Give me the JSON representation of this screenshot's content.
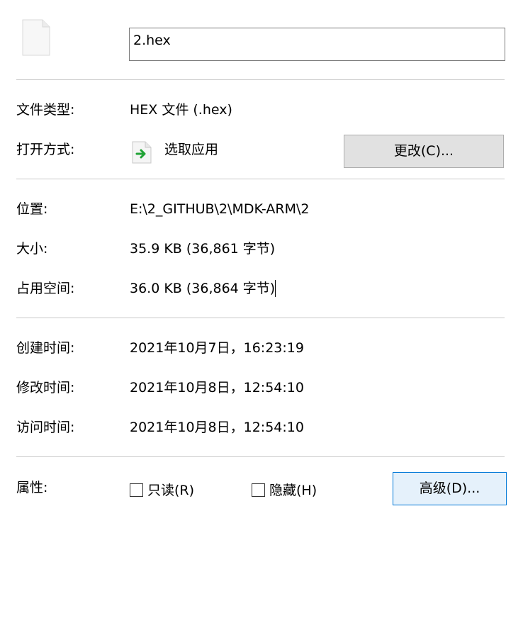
{
  "file": {
    "name": "2.hex",
    "icon": "blank-file-icon"
  },
  "type_row": {
    "label": "文件类型:",
    "value": "HEX 文件 (.hex)"
  },
  "open_row": {
    "label": "打开方式:",
    "app": "选取应用",
    "app_icon": "open-with-arrow-icon",
    "change_button": "更改(C)..."
  },
  "location_row": {
    "label": "位置:",
    "value": "E:\\2_GITHUB\\2\\MDK-ARM\\2"
  },
  "size_row": {
    "label": "大小:",
    "value": "35.9 KB (36,861 字节)"
  },
  "disk_row": {
    "label": "占用空间:",
    "value": "36.0 KB (36,864 字节)"
  },
  "created_row": {
    "label": "创建时间:",
    "value": "2021年10月7日，16:23:19"
  },
  "modified_row": {
    "label": "修改时间:",
    "value": "2021年10月8日，12:54:10"
  },
  "accessed_row": {
    "label": "访问时间:",
    "value": "2021年10月8日，12:54:10"
  },
  "attributes": {
    "label": "属性:",
    "readonly": {
      "label": "只读(R)",
      "checked": false
    },
    "hidden": {
      "label": "隐藏(H)",
      "checked": false
    },
    "advanced_button": "高级(D)..."
  },
  "colors": {
    "accent": "#0078d7",
    "separator": "#c9c9c9",
    "button_bg": "#e1e1e1",
    "focus_bg": "#e5f1fb"
  }
}
